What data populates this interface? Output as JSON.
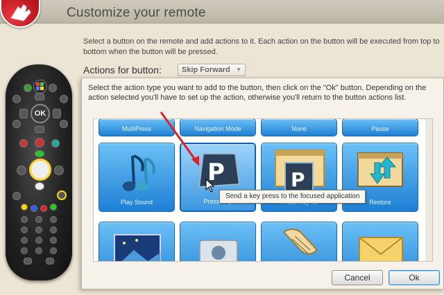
{
  "header": {
    "title": "Customize your remote",
    "icon": "hand-pointer-icon"
  },
  "description": "Select a button on the remote and add actions to it. Each action on the button will be executed from top to bottom when the button will be pressed.",
  "actions": {
    "label": "Actions for button:",
    "selected_button": "Skip Forward"
  },
  "dialog": {
    "instructions": "Select the action type you want to add to the button, then click on the \"Ok\" button. Depending on the action selected you'll have to set up the action, otherwise you'll return to the button actions list.",
    "tiles_row0": [
      "MultiPress",
      "Navigation Mode",
      "None",
      "Pause"
    ],
    "tiles_row1": [
      {
        "label": "Play Sound",
        "icon": "music-note-icon"
      },
      {
        "label": "Press Key",
        "icon": "key-p-icon"
      },
      {
        "label": "Press Key To",
        "icon": "key-p-window-icon"
      },
      {
        "label": "Restore",
        "icon": "restore-window-icon"
      }
    ],
    "tiles_row2": [
      {
        "icon": "landscape-icon"
      },
      {
        "icon": "camera-icon"
      },
      {
        "icon": "scroll-icon"
      },
      {
        "icon": "envelope-icon"
      }
    ],
    "tooltip": "Send a key press to the focused application",
    "cancel_label": "Cancel",
    "ok_label": "Ok"
  },
  "remote": {
    "ok_label": "OK"
  },
  "colors": {
    "tile_top": "#6cc0f5",
    "tile_bottom": "#1e7fd3",
    "arrow": "#e02020"
  }
}
